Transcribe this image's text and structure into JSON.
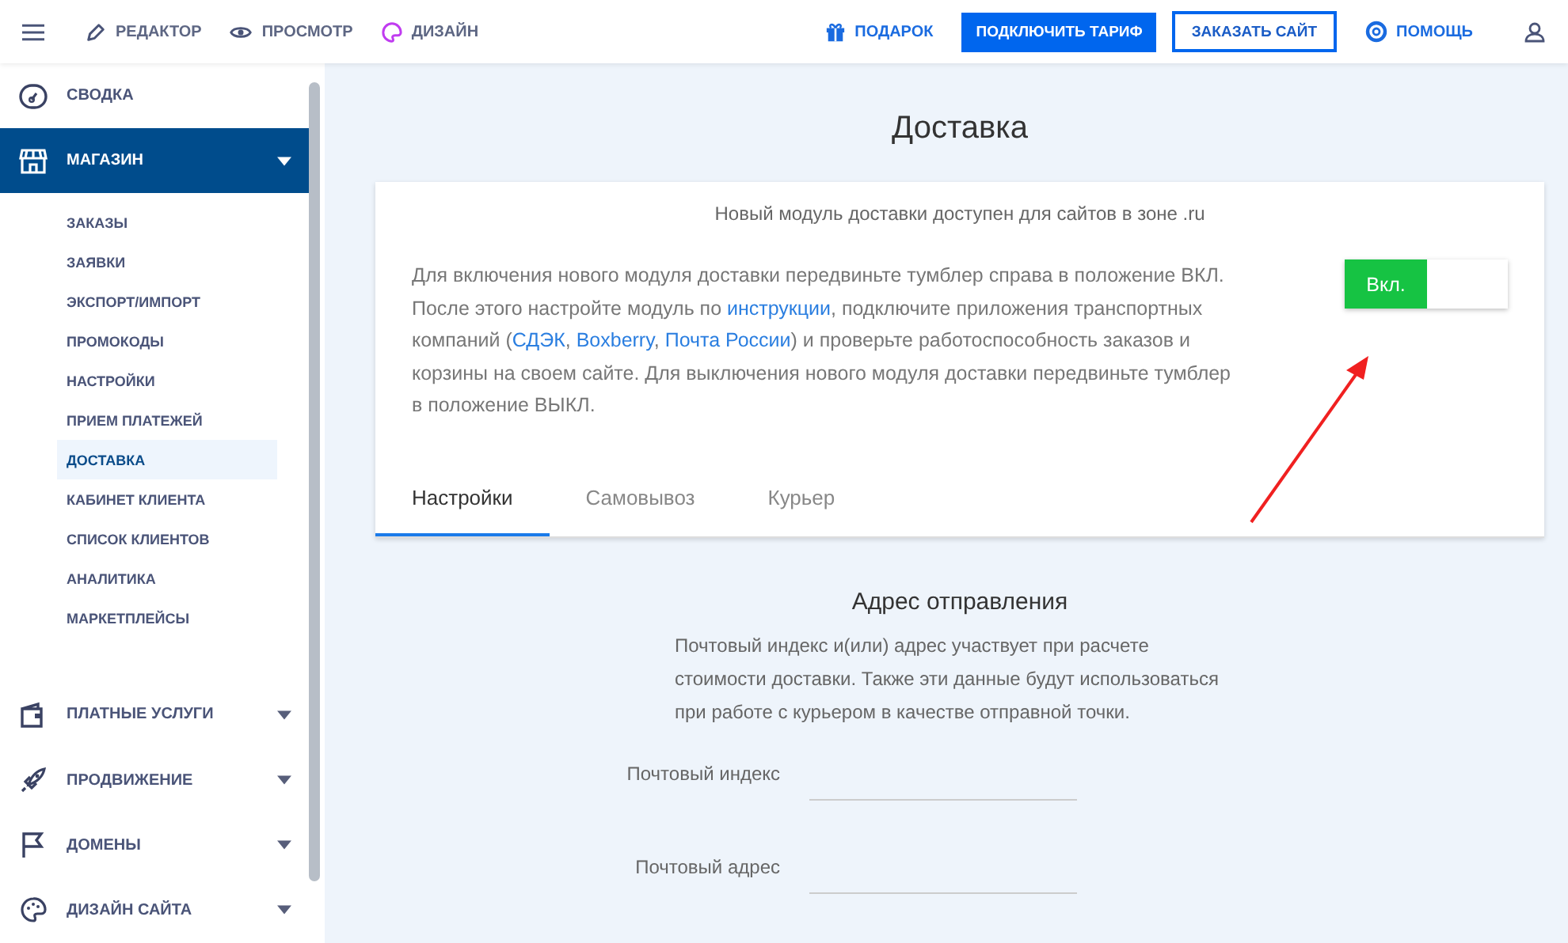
{
  "topbar": {
    "modes": [
      {
        "label": "РЕДАКТОР"
      },
      {
        "label": "ПРОСМОТР"
      },
      {
        "label": "ДИЗАЙН"
      }
    ],
    "gift": "ПОДАРОК",
    "primary_button": "ПОДКЛЮЧИТЬ ТАРИФ",
    "secondary_button": "ЗАКАЗАТЬ САЙТ",
    "help": "ПОМОЩЬ"
  },
  "sidebar": {
    "items": [
      {
        "label": "СВОДКА",
        "kind": "link",
        "selected": false
      },
      {
        "label": "МАГАЗИН",
        "kind": "group",
        "selected": true,
        "expanded": true,
        "children": [
          {
            "label": "ЗАКАЗЫ",
            "selected": false
          },
          {
            "label": "ЗАЯВКИ",
            "selected": false
          },
          {
            "label": "ЭКСПОРТ/ИМПОРТ",
            "selected": false
          },
          {
            "label": "ПРОМОКОДЫ",
            "selected": false
          },
          {
            "label": "НАСТРОЙКИ",
            "selected": false
          },
          {
            "label": "ПРИЕМ ПЛАТЕЖЕЙ",
            "selected": false
          },
          {
            "label": "ДОСТАВКА",
            "selected": true
          },
          {
            "label": "КАБИНЕТ КЛИЕНТА",
            "selected": false
          },
          {
            "label": "СПИСОК КЛИЕНТОВ",
            "selected": false
          },
          {
            "label": "АНАЛИТИКА",
            "selected": false
          },
          {
            "label": "МАРКЕТПЛЕЙСЫ",
            "selected": false
          }
        ]
      },
      {
        "label": "ПЛАТНЫЕ УСЛУГИ",
        "kind": "group",
        "selected": false,
        "expanded": false
      },
      {
        "label": "ПРОДВИЖЕНИЕ",
        "kind": "group",
        "selected": false,
        "expanded": false
      },
      {
        "label": "ДОМЕНЫ",
        "kind": "group",
        "selected": false,
        "expanded": false
      },
      {
        "label": "ДИЗАЙН САЙТА",
        "kind": "group",
        "selected": false,
        "expanded": false
      }
    ]
  },
  "page": {
    "title": "Доставка",
    "card": {
      "notice": "Новый модуль доставки доступен для сайтов в зоне .ru",
      "description": [
        {
          "text": "Для включения нового модуля доставки передвиньте тумблер справа в положение ВКЛ. После этого настройте модуль по ",
          "link": false
        },
        {
          "text": "инструкции",
          "link": true
        },
        {
          "text": ", подключите приложения транспортных компаний (",
          "link": false
        },
        {
          "text": "СДЭК",
          "link": true
        },
        {
          "text": ", ",
          "link": false
        },
        {
          "text": "Boxberry",
          "link": true
        },
        {
          "text": ", ",
          "link": false
        },
        {
          "text": "Почта России",
          "link": true
        },
        {
          "text": ") и проверьте работоспособность заказов и корзины на своем сайте. Для выключения нового модуля доставки передвиньте тумблер в положение ВЫКЛ.",
          "link": false
        }
      ],
      "toggle": {
        "label": "Вкл.",
        "on": true
      },
      "tabs": [
        {
          "label": "Настройки",
          "selected": true
        },
        {
          "label": "Самовывоз",
          "selected": false
        },
        {
          "label": "Курьер",
          "selected": false
        }
      ]
    },
    "section": {
      "heading": "Адрес отправления",
      "description": "Почтовый индекс и(или) адрес участвует при расчете стоимости доставки. Также эти данные будут использоваться при работе с курьером в качестве отправной точки.",
      "fields": [
        {
          "label": "Почтовый индекс"
        },
        {
          "label": "Почтовый адрес"
        }
      ]
    }
  }
}
